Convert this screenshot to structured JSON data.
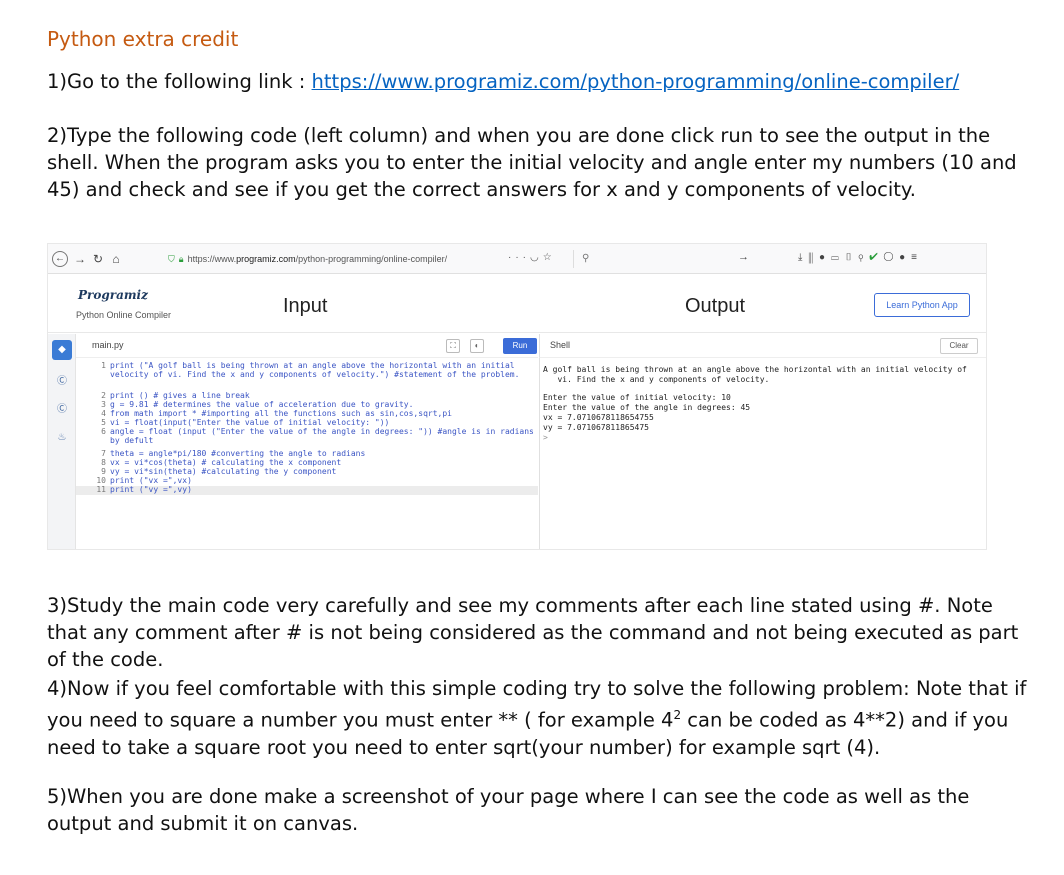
{
  "doc": {
    "title": "Python extra credit",
    "step1_prefix": "1)Go to the following link : ",
    "step1_link": "https://www.programiz.com/python-programming/online-compiler/",
    "step2": "2)Type the following code (left column) and when you are done click run to see the output in the shell. When the program asks you to enter the initial velocity and angle enter my numbers (10 and 45) and check and see if you get the correct answers for x and y components of velocity.",
    "step3": "3)Study the main code very carefully and see my comments after each line stated using #. Note that any comment after # is not being considered as the command and not being executed as part of the code.",
    "step4_a": "4)Now if you feel comfortable with this simple coding try to solve the following problem: Note that if you need to square a number you must enter ** ( for example 4",
    "step4_sup": "2",
    "step4_b": " can be coded as 4**2) and if you need to take a square root you need to enter sqrt(your number) for example sqrt (4).",
    "step5": "5)When you are done make a screenshot of your page where I can see the code as well as the output and submit it on canvas."
  },
  "browser": {
    "url_prefix": "https://www.",
    "url_host": "programiz.com",
    "url_path": "/python-programming/online-compiler/"
  },
  "app": {
    "logo": "Programiz",
    "subtitle": "Python Online Compiler",
    "input_heading": "Input",
    "output_heading": "Output",
    "learn_button": "Learn Python App",
    "file_name": "main.py",
    "run_label": "Run",
    "shell_label": "Shell",
    "clear_label": "Clear"
  },
  "code_lines": [
    {
      "n": "1",
      "text": "print (\"A golf ball is being thrown at an angle above the horizontal with an initial velocity of vi. Find the x and y components of velocity.\") #statement of the problem."
    },
    {
      "n": "2",
      "text": "print () # gives a line break"
    },
    {
      "n": "3",
      "text": "g = 9.81 # determines the value of acceleration due to gravity."
    },
    {
      "n": "4",
      "text": "from math import * #importing all the functions such as sin,cos,sqrt,pi"
    },
    {
      "n": "5",
      "text": "vi = float(input(\"Enter the value of initial velocity: \"))"
    },
    {
      "n": "6",
      "text": "angle = float (input (\"Enter the value of the angle in degrees: \")) #angle is in radians by defult"
    },
    {
      "n": "7",
      "text": "theta = angle*pi/180 #converting the angle to radians"
    },
    {
      "n": "8",
      "text": "vx = vi*cos(theta) # calculating the x component"
    },
    {
      "n": "9",
      "text": "vy = vi*sin(theta) #calculating the y component"
    },
    {
      "n": "10",
      "text": "print (\"vx =\",vx)"
    },
    {
      "n": "11",
      "text": "print (\"vy =\",vy)"
    }
  ],
  "shell_lines": [
    "A golf ball is being thrown at an angle above the horizontal with an initial velocity of\n   vi. Find the x and y components of velocity.",
    "",
    "Enter the value of initial velocity: 10",
    "Enter the value of the angle in degrees: 45",
    "vx = 7.0710678118654755",
    "vy = 7.071067811865475",
    ">"
  ]
}
